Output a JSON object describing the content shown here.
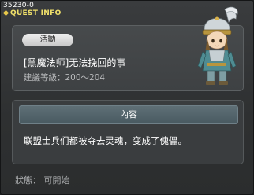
{
  "window": {
    "quest_id": "35230-0",
    "title": "QUEST INFO"
  },
  "quest": {
    "tag": "活動",
    "name": "[黑魔法师]无法挽回的事",
    "level_requirement": "建議等級：200～204"
  },
  "content": {
    "header": "內容",
    "description": "联盟士兵们都被夺去灵魂，变成了傀儡。"
  },
  "status": "狀態： 可開始",
  "colors": {
    "title": "#f0e06a",
    "panel": "#474a4c",
    "header": "#5f6f76"
  }
}
